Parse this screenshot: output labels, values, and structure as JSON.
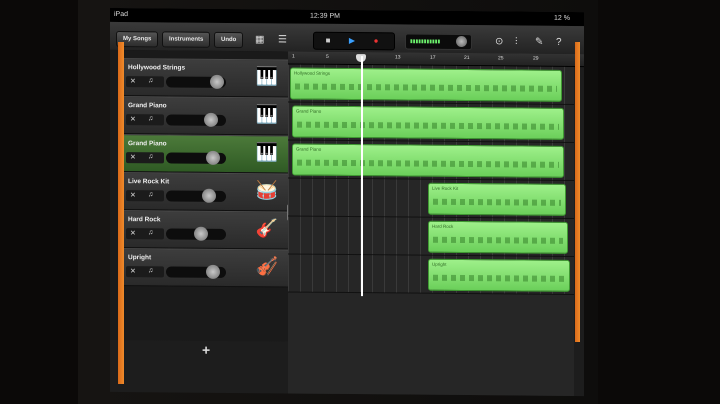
{
  "statusbar": {
    "device": "iPad",
    "time": "12:39 PM",
    "battery": "12 %"
  },
  "toolbar": {
    "my_songs": "My Songs",
    "instruments": "Instruments",
    "undo": "Undo",
    "meter": "▮▮▮▮▮▮▮▮▮▮▮"
  },
  "ruler": {
    "marks": [
      "1",
      "5",
      "9",
      "13",
      "17",
      "21",
      "25",
      "29"
    ]
  },
  "tracks": [
    {
      "name": "Hollywood Strings",
      "icon": "keyboard-icon",
      "regions": [
        {
          "label": "Hollywood Strings"
        }
      ]
    },
    {
      "name": "Grand Piano",
      "icon": "grand-piano-icon",
      "regions": [
        {
          "label": "Grand Piano"
        }
      ]
    },
    {
      "name": "Grand Piano",
      "icon": "grand-piano-icon",
      "selected": true,
      "regions": [
        {
          "label": "Grand Piano"
        }
      ]
    },
    {
      "name": "Live Rock Kit",
      "icon": "drum-kit-icon",
      "regions": [
        {
          "label": "Live Rock Kit"
        }
      ]
    },
    {
      "name": "Hard Rock",
      "icon": "electric-guitar-icon",
      "regions": [
        {
          "label": "Hard Rock"
        }
      ]
    },
    {
      "name": "Upright",
      "icon": "upright-bass-icon",
      "regions": [
        {
          "label": "Upright"
        }
      ]
    }
  ],
  "add_track": "+"
}
